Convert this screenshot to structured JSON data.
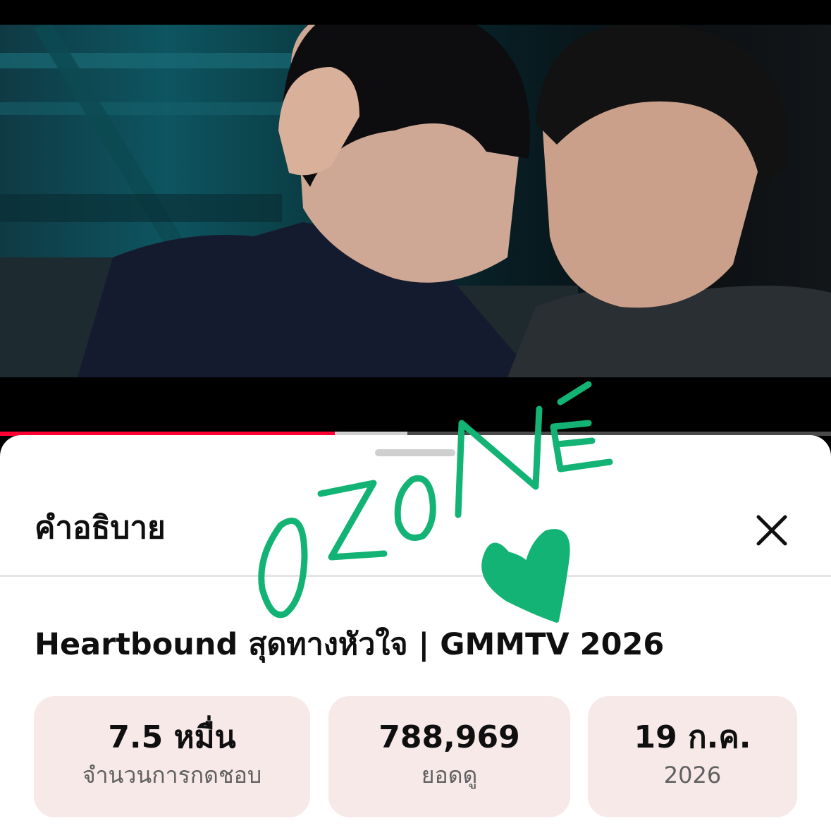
{
  "player": {
    "progress_played": 0.403,
    "progress_buffered": 0.49
  },
  "sheet": {
    "title": "คำอธิบาย",
    "close_icon": "close-icon"
  },
  "video": {
    "title": "Heartbound สุดทางหัวใจ | GMMTV 2026"
  },
  "stats": [
    {
      "value": "7.5 หมื่น",
      "label": "จำนวนการกดชอบ"
    },
    {
      "value": "788,969",
      "label": "ยอดดู"
    },
    {
      "value": "19 ก.ค.",
      "label": "2026"
    }
  ],
  "doodle": {
    "text": "OZONÉ",
    "color": "#12b374"
  },
  "colors": {
    "accent_red": "#ff0033",
    "stat_bg": "#f8e9e9"
  }
}
